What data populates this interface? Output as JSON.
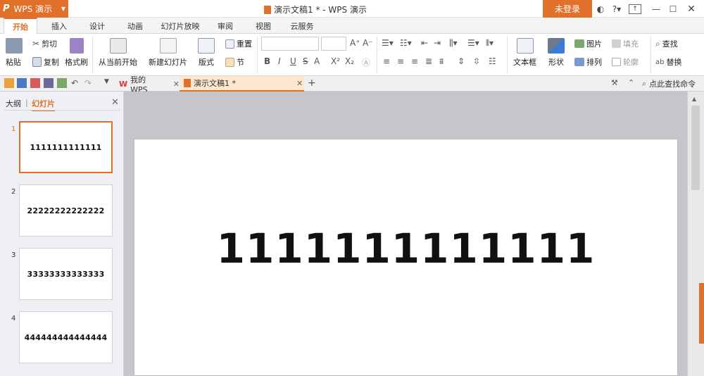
{
  "app": {
    "name": "WPS 演示",
    "logo": "P"
  },
  "title": "演示文稿1 * - WPS 演示",
  "login": "未登录",
  "ribbon_tabs": [
    {
      "label": "开始",
      "active": true
    },
    {
      "label": "插入"
    },
    {
      "label": "设计"
    },
    {
      "label": "动画"
    },
    {
      "label": "幻灯片放映"
    },
    {
      "label": "审阅"
    },
    {
      "label": "视图"
    },
    {
      "label": "云服务"
    }
  ],
  "ribbon": {
    "paste": "粘贴",
    "cut": "剪切",
    "copy": "复制",
    "format_painter": "格式刷",
    "from_current": "从当前开始",
    "new_slide": "新建幻灯片",
    "layout": "版式",
    "reset": "重置",
    "section": "节",
    "text_box": "文本框",
    "shape": "形状",
    "picture": "图片",
    "arrange": "排列",
    "fill": "填充",
    "outline": "轮廓",
    "find": "查找",
    "replace": "替换",
    "bold": "B",
    "italic": "I",
    "underline": "U",
    "strike": "S",
    "shadow": "S",
    "font_color": "A",
    "superscript": "X²",
    "subscript": "X₂"
  },
  "doc_tabs": [
    {
      "label": "我的WPS"
    },
    {
      "label": "演示文稿1 *",
      "active": true
    }
  ],
  "search_command": "点此查找命令",
  "panel_tabs": {
    "outline": "大纲",
    "slides": "幻灯片"
  },
  "slides": [
    {
      "num": "1",
      "text": "1111111111111"
    },
    {
      "num": "2",
      "text": "22222222222222"
    },
    {
      "num": "3",
      "text": "33333333333333"
    },
    {
      "num": "4",
      "text": "444444444444444"
    }
  ],
  "main_slide_text": "1111111111111",
  "colors": {
    "accent": "#e0702a",
    "canvas": "#c4c6cc"
  }
}
